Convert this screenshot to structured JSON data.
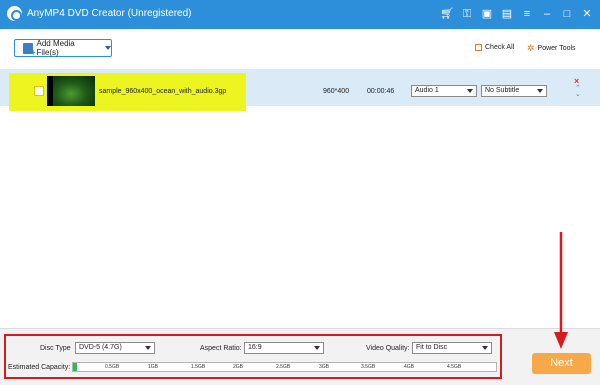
{
  "app": {
    "title": "AnyMP4 DVD Creator (Unregistered)"
  },
  "titlebar_icons": [
    "cart-icon",
    "register-key-icon",
    "gift-icon",
    "feedback-icon",
    "menu-icon",
    "minimize-icon",
    "maximize-icon",
    "close-icon"
  ],
  "toolbar": {
    "add_media_label": "Add Media File(s)",
    "check_all_label": "Check All",
    "power_tools_label": "Power Tools"
  },
  "file": {
    "name": "sample_960x400_ocean_with_audio.3gp",
    "resolution": "960*400",
    "duration": "00:00:46",
    "audio": "Audio 1",
    "subtitle": "No Subtitle",
    "checked": false
  },
  "settings": {
    "disc_type_label": "Disc Type",
    "disc_type_value": "DVD-5 (4.7G)",
    "aspect_ratio_label": "Aspect Ratio:",
    "aspect_ratio_value": "16:9",
    "video_quality_label": "Video Quality:",
    "video_quality_value": "Fit to Disc",
    "capacity_label": "Estimated Capacity:",
    "capacity_ticks": [
      "0.5GB",
      "1GB",
      "1.5GB",
      "2GB",
      "2.5GB",
      "3GB",
      "3.5GB",
      "4GB",
      "4.5GB"
    ],
    "capacity_used_fraction": 0.01
  },
  "next_label": "Next",
  "colors": {
    "titlebar": "#2d8fda",
    "highlight": "#ecf520",
    "annotation_red": "#d51c1c",
    "next_button": "#f7a94a",
    "capacity_fill": "#2ebc5a"
  }
}
